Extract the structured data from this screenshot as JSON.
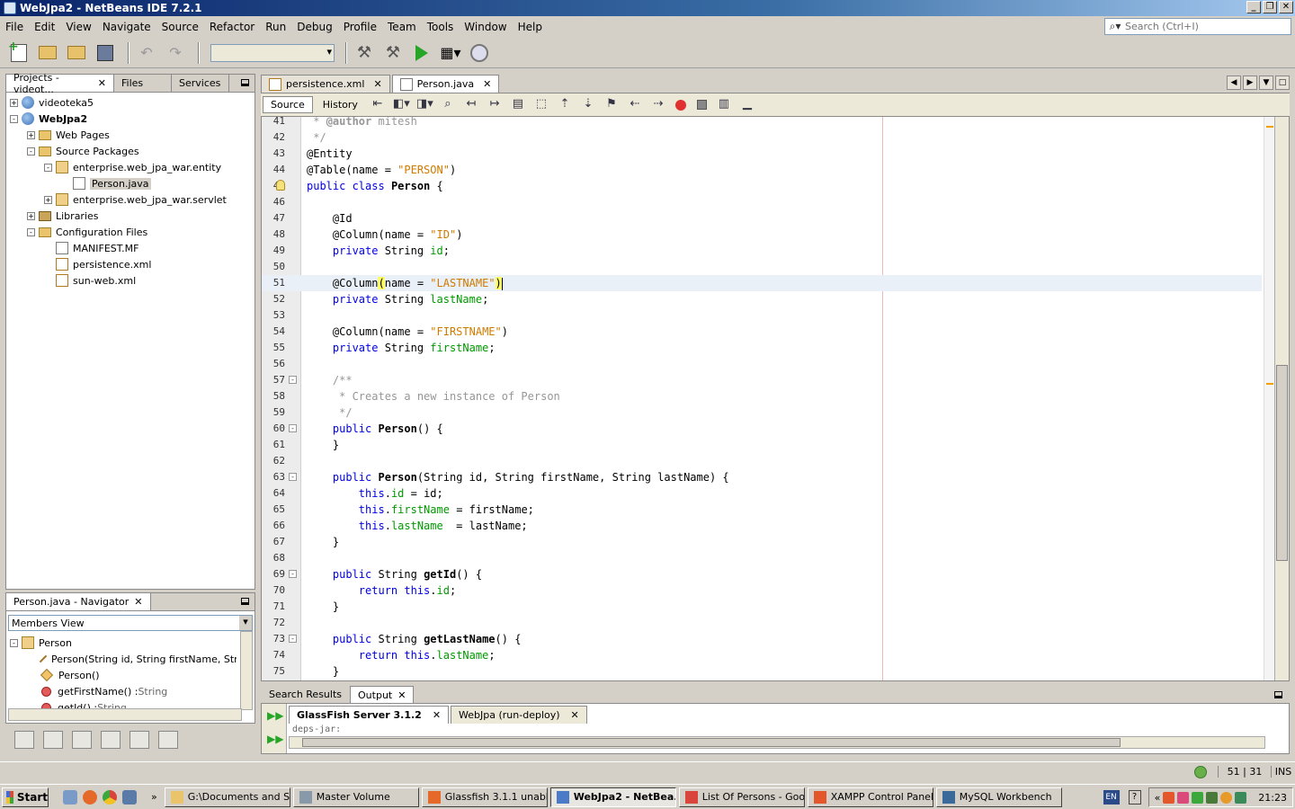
{
  "window": {
    "title": "WebJpa2 - NetBeans IDE 7.2.1"
  },
  "menu": [
    "File",
    "Edit",
    "View",
    "Navigate",
    "Source",
    "Refactor",
    "Run",
    "Debug",
    "Profile",
    "Team",
    "Tools",
    "Window",
    "Help"
  ],
  "search": {
    "placeholder": "Search (Ctrl+I)"
  },
  "projects_panel": {
    "tabs": [
      "Projects - videot...",
      "Files",
      "Services"
    ],
    "tree": [
      {
        "label": "videoteka5",
        "depth": 0,
        "expander": "+",
        "icon": "globe-icon"
      },
      {
        "label": "WebJpa2",
        "depth": 0,
        "expander": "-",
        "icon": "globe-icon",
        "bold": true
      },
      {
        "label": "Web Pages",
        "depth": 1,
        "expander": "+",
        "icon": "folder-icon"
      },
      {
        "label": "Source Packages",
        "depth": 1,
        "expander": "-",
        "icon": "folder-icon"
      },
      {
        "label": "enterprise.web_jpa_war.entity",
        "depth": 2,
        "expander": "-",
        "icon": "package-icon"
      },
      {
        "label": "Person.java",
        "depth": 3,
        "expander": "",
        "icon": "java-file-icon",
        "selected": true
      },
      {
        "label": "enterprise.web_jpa_war.servlet",
        "depth": 2,
        "expander": "+",
        "icon": "package-icon"
      },
      {
        "label": "Libraries",
        "depth": 1,
        "expander": "+",
        "icon": "library-icon"
      },
      {
        "label": "Configuration Files",
        "depth": 1,
        "expander": "-",
        "icon": "folder-icon"
      },
      {
        "label": "MANIFEST.MF",
        "depth": 2,
        "expander": "",
        "icon": "file-icon"
      },
      {
        "label": "persistence.xml",
        "depth": 2,
        "expander": "",
        "icon": "xml-file-icon"
      },
      {
        "label": "sun-web.xml",
        "depth": 2,
        "expander": "",
        "icon": "xml-file-icon"
      }
    ]
  },
  "navigator": {
    "tab": "Person.java - Navigator",
    "view": "Members View",
    "root": "Person",
    "members": [
      {
        "kind": "constructor",
        "name": "Person(String id, String firstName, String",
        "type": ""
      },
      {
        "kind": "constructor",
        "name": "Person()",
        "type": ""
      },
      {
        "kind": "method",
        "name": "getFirstName() : ",
        "type": "String"
      },
      {
        "kind": "method",
        "name": "getId() : ",
        "type": "String"
      }
    ]
  },
  "editor": {
    "tabs": [
      {
        "label": "persistence.xml",
        "active": false
      },
      {
        "label": "Person.java",
        "active": true
      }
    ],
    "source_label": "Source",
    "history_label": "History",
    "lines": [
      {
        "n": "41",
        "html": "<span class='cmt'> * <b>@author</b> mitesh</span>"
      },
      {
        "n": "42",
        "html": "<span class='cmt'> */</span>"
      },
      {
        "n": "43",
        "html": "<span class='ann'>@Entity</span>"
      },
      {
        "n": "44",
        "html": "<span class='ann'>@Table</span>(name = <span class='str'>\"PERSON\"</span>)"
      },
      {
        "n": "45",
        "html": "<span class='kw'>public class</span> <span class='bold'>Person</span> {",
        "bulb": true
      },
      {
        "n": "46",
        "html": ""
      },
      {
        "n": "47",
        "html": "    <span class='ann'>@Id</span>"
      },
      {
        "n": "48",
        "html": "    <span class='ann'>@Column</span>(name = <span class='str'>\"ID\"</span>)"
      },
      {
        "n": "49",
        "html": "    <span class='kw'>private</span> String <span class='field'>id</span>;"
      },
      {
        "n": "50",
        "html": ""
      },
      {
        "n": "51",
        "html": "    <span class='ann'>@Column</span><span class='paren-hl'>(</span>name = <span class='str'>\"LASTNAME\"</span><span class='paren-hl'>)</span><span class='caret'></span>",
        "current": true
      },
      {
        "n": "52",
        "html": "    <span class='kw'>private</span> String <span class='field'>lastName</span>;"
      },
      {
        "n": "53",
        "html": ""
      },
      {
        "n": "54",
        "html": "    <span class='ann'>@Column</span>(name = <span class='str'>\"FIRSTNAME\"</span>)"
      },
      {
        "n": "55",
        "html": "    <span class='kw'>private</span> String <span class='field'>firstName</span>;"
      },
      {
        "n": "56",
        "html": ""
      },
      {
        "n": "57",
        "html": "    <span class='cmt'>/**</span>",
        "fold": "-"
      },
      {
        "n": "58",
        "html": "    <span class='cmt'> * Creates a new instance of Person</span>"
      },
      {
        "n": "59",
        "html": "    <span class='cmt'> */</span>"
      },
      {
        "n": "60",
        "html": "    <span class='kw'>public</span> <span class='bold'>Person</span>() {",
        "fold": "-"
      },
      {
        "n": "61",
        "html": "    }"
      },
      {
        "n": "62",
        "html": ""
      },
      {
        "n": "63",
        "html": "    <span class='kw'>public</span> <span class='bold'>Person</span>(String id, String firstName, String lastName) {",
        "fold": "-"
      },
      {
        "n": "64",
        "html": "        <span class='kw'>this</span>.<span class='field'>id</span> = id;"
      },
      {
        "n": "65",
        "html": "        <span class='kw'>this</span>.<span class='field'>firstName</span> = firstName;"
      },
      {
        "n": "66",
        "html": "        <span class='kw'>this</span>.<span class='field'>lastName</span>  = lastName;"
      },
      {
        "n": "67",
        "html": "    }"
      },
      {
        "n": "68",
        "html": ""
      },
      {
        "n": "69",
        "html": "    <span class='kw'>public</span> String <span class='bold'>getId</span>() {",
        "fold": "-"
      },
      {
        "n": "70",
        "html": "        <span class='kw'>return this</span>.<span class='field'>id</span>;"
      },
      {
        "n": "71",
        "html": "    }"
      },
      {
        "n": "72",
        "html": ""
      },
      {
        "n": "73",
        "html": "    <span class='kw'>public</span> String <span class='bold'>getLastName</span>() {",
        "fold": "-"
      },
      {
        "n": "74",
        "html": "        <span class='kw'>return this</span>.<span class='field'>lastName</span>;"
      },
      {
        "n": "75",
        "html": "    }"
      }
    ]
  },
  "output": {
    "tabs": [
      {
        "label": "Search Results",
        "active": false,
        "closable": false
      },
      {
        "label": "Output",
        "active": true,
        "closable": true
      }
    ],
    "subtabs": [
      {
        "label": "GlassFish Server 3.1.2",
        "active": true
      },
      {
        "label": "WebJpa (run-deploy)",
        "active": false
      }
    ],
    "text": "deps-jar:"
  },
  "status": {
    "position": "51 | 31",
    "mode": "INS"
  },
  "taskbar": {
    "start": "Start",
    "tasks": [
      {
        "label": "G:\\Documents and S...",
        "width": 140,
        "icon": "folder-icon",
        "color": "#e9c46a"
      },
      {
        "label": "Master Volume",
        "width": 140,
        "icon": "volume-icon",
        "color": "#8899aa"
      },
      {
        "label": "Glassfish 3.1.1 unabl...",
        "width": 140,
        "icon": "firefox-icon",
        "color": "#e56a2a"
      },
      {
        "label": "WebJpa2 - NetBea...",
        "width": 140,
        "icon": "netbeans-icon",
        "color": "#4a7ac8",
        "active": true
      },
      {
        "label": "List Of Persons - Goo...",
        "width": 140,
        "icon": "chrome-icon",
        "color": "#d9453a"
      },
      {
        "label": "XAMPP Control Panel ...",
        "width": 140,
        "icon": "xampp-icon",
        "color": "#e3572a"
      },
      {
        "label": "MySQL Workbench",
        "width": 140,
        "icon": "mysql-icon",
        "color": "#3a6a9a"
      }
    ],
    "lang": "EN",
    "clock": "21:23"
  }
}
